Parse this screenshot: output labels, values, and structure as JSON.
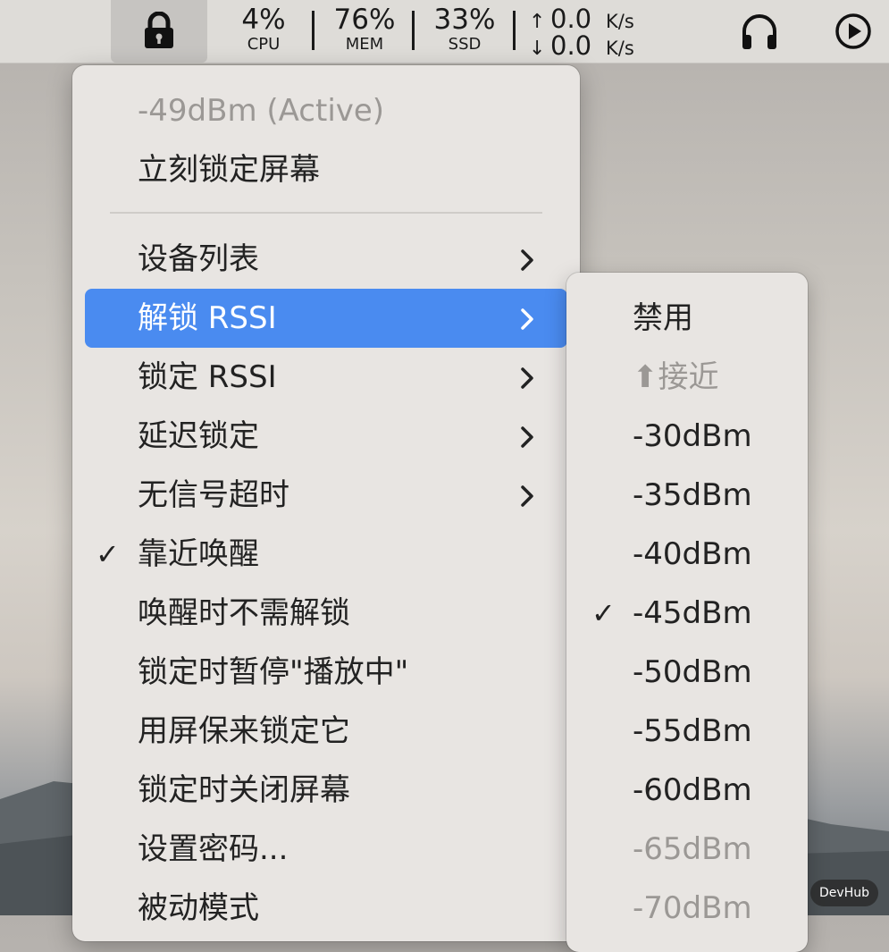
{
  "menubar": {
    "lock_icon": "lock-icon",
    "stats": [
      {
        "value": "4%",
        "label": "CPU"
      },
      {
        "value": "76%",
        "label": "MEM"
      },
      {
        "value": "33%",
        "label": "SSD"
      }
    ],
    "network": {
      "up_value": "0.0",
      "up_unit": "K/s",
      "down_value": "0.0",
      "down_unit": "K/s",
      "up_arrow": "↑",
      "down_arrow": "↓"
    },
    "icons": [
      "headphones-icon",
      "play-circle-icon"
    ]
  },
  "menu": {
    "status": "-49dBm (Active)",
    "lock_now": "立刻锁定屏幕",
    "items": [
      {
        "label": "设备列表",
        "submenu": true
      },
      {
        "label": "解锁 RSSI",
        "submenu": true,
        "highlighted": true
      },
      {
        "label": "锁定 RSSI",
        "submenu": true
      },
      {
        "label": "延迟锁定",
        "submenu": true
      },
      {
        "label": "无信号超时",
        "submenu": true
      },
      {
        "label": "靠近唤醒",
        "checked": true
      },
      {
        "label": "唤醒时不需解锁"
      },
      {
        "label": "锁定时暂停\"播放中\""
      },
      {
        "label": "用屏保来锁定它"
      },
      {
        "label": "锁定时关闭屏幕"
      },
      {
        "label": "设置密码..."
      },
      {
        "label": "被动模式"
      }
    ],
    "check_mark": "✓"
  },
  "submenu": {
    "items": [
      {
        "label": "禁用"
      },
      {
        "label": "⬆接近",
        "disabled": true
      },
      {
        "label": "-30dBm"
      },
      {
        "label": "-35dBm"
      },
      {
        "label": "-40dBm"
      },
      {
        "label": "-45dBm",
        "checked": true
      },
      {
        "label": "-50dBm"
      },
      {
        "label": "-55dBm"
      },
      {
        "label": "-60dBm"
      },
      {
        "label": "-65dBm",
        "disabled": true
      },
      {
        "label": "-70dBm",
        "disabled": true
      }
    ]
  },
  "watermark": "DevHub",
  "colors": {
    "highlight": "#4a8bf0",
    "menu_bg": "#e8e5e2",
    "menubar_bg": "#dedcd8",
    "disabled_text": "#9b9895"
  }
}
